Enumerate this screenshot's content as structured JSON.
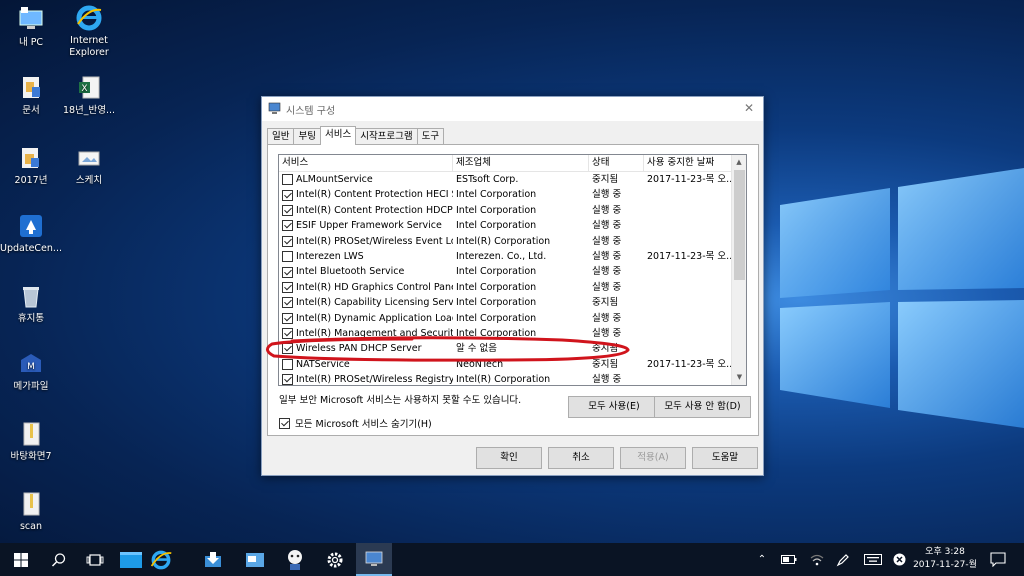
{
  "desktop": {
    "icons": [
      {
        "label": "내 PC"
      },
      {
        "label": "Internet Explorer"
      },
      {
        "label": "문서"
      },
      {
        "label": "18년_반영..."
      },
      {
        "label": "2017년"
      },
      {
        "label": "스케치"
      },
      {
        "label": "UpdateCen..."
      },
      {
        "label": "휴지통"
      },
      {
        "label": "메가파일"
      },
      {
        "label": "바탕화면7"
      },
      {
        "label": "scan"
      }
    ]
  },
  "dialog": {
    "title": "시스템 구성",
    "close_glyph": "✕",
    "tabs": [
      "일반",
      "부팅",
      "서비스",
      "시작프로그램",
      "도구"
    ],
    "active_tab": 2,
    "list": {
      "headers": [
        "서비스",
        "제조업체",
        "상태",
        "사용 중지한 날짜"
      ],
      "rows": [
        {
          "checked": false,
          "name": "ALMountService",
          "maker": "ESTsoft Corp.",
          "status": "중지됨",
          "date": "2017-11-23-목 오..."
        },
        {
          "checked": true,
          "name": "Intel(R) Content Protection HECI S...",
          "maker": "Intel Corporation",
          "status": "실행 중",
          "date": ""
        },
        {
          "checked": true,
          "name": "Intel(R) Content Protection HDCP ...",
          "maker": "Intel Corporation",
          "status": "실행 중",
          "date": ""
        },
        {
          "checked": true,
          "name": "ESIF Upper Framework Service",
          "maker": "Intel Corporation",
          "status": "실행 중",
          "date": ""
        },
        {
          "checked": true,
          "name": "Intel(R) PROSet/Wireless Event Log",
          "maker": "Intel(R) Corporation",
          "status": "실행 중",
          "date": ""
        },
        {
          "checked": false,
          "name": "Interezen LWS",
          "maker": "Interezen. Co., Ltd.",
          "status": "실행 중",
          "date": "2017-11-23-목 오..."
        },
        {
          "checked": true,
          "name": "Intel Bluetooth Service",
          "maker": "Intel Corporation",
          "status": "실행 중",
          "date": ""
        },
        {
          "checked": true,
          "name": "Intel(R) HD Graphics Control Panel...",
          "maker": "Intel Corporation",
          "status": "실행 중",
          "date": ""
        },
        {
          "checked": true,
          "name": "Intel(R) Capability Licensing Servic...",
          "maker": "Intel Corporation",
          "status": "중지됨",
          "date": ""
        },
        {
          "checked": true,
          "name": "Intel(R) Dynamic Application Load...",
          "maker": "Intel Corporation",
          "status": "실행 중",
          "date": ""
        },
        {
          "checked": true,
          "name": "Intel(R) Management and Security...",
          "maker": "Intel Corporation",
          "status": "실행 중",
          "date": ""
        },
        {
          "checked": true,
          "name": "Wireless PAN DHCP Server",
          "maker": "알 수 없음",
          "status": "중지됨",
          "date": ""
        },
        {
          "checked": false,
          "name": "NATService",
          "maker": "NeoNTech",
          "status": "중지됨",
          "date": "2017-11-23-목 오..."
        },
        {
          "checked": true,
          "name": "Intel(R) PROSet/Wireless Registry ...",
          "maker": "Intel(R) Corporation",
          "status": "실행 중",
          "date": ""
        }
      ]
    },
    "note": "일부 보안 Microsoft 서비스는 사용하지 못할 수도 있습니다.",
    "enable_all": "모두 사용(E)",
    "disable_all": "모두 사용 안 함(D)",
    "hide_ms": {
      "checked": true,
      "label": "모든 Microsoft 서비스 숨기기(H)"
    },
    "buttons": {
      "ok": "확인",
      "cancel": "취소",
      "apply": "적용(A)",
      "help": "도움말"
    },
    "highlight_color": "#d0141c"
  },
  "taskbar": {
    "clock_time": "오후 3:28",
    "clock_date": "2017-11-27-월"
  }
}
